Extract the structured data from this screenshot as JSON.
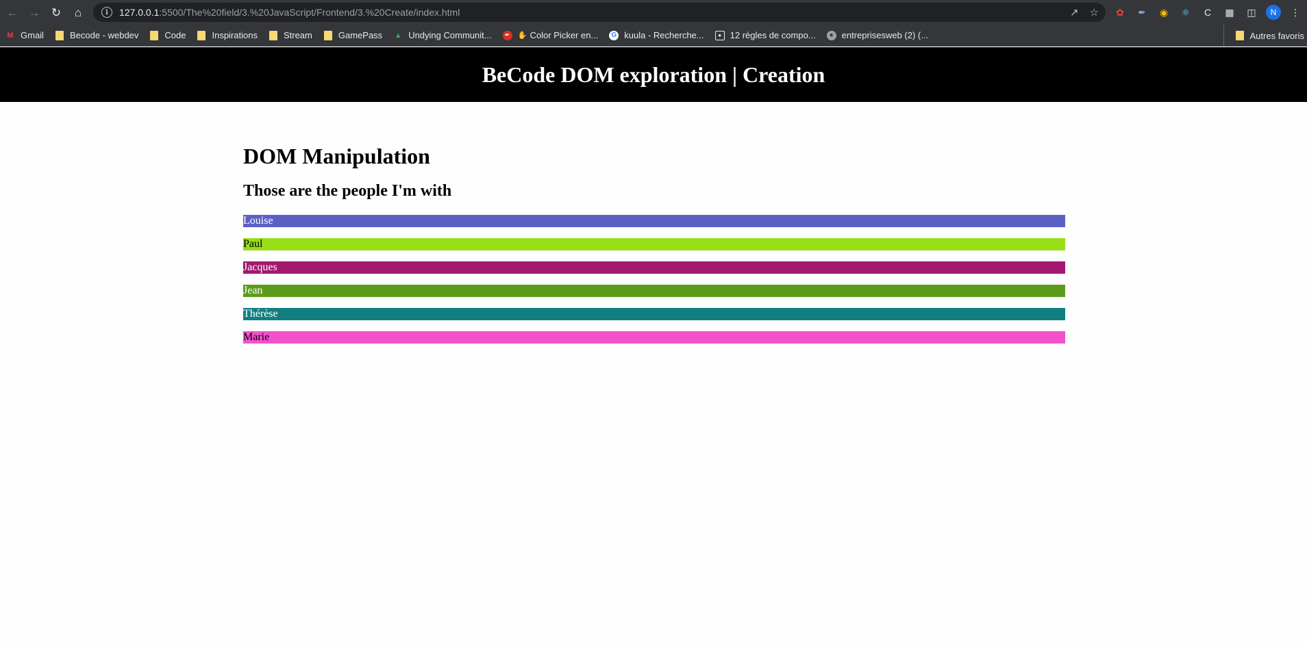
{
  "browser": {
    "url_host": "127.0.0.1",
    "url_rest": ":5500/The%20field/3.%20JavaScript/Frontend/3.%20Create/index.html",
    "profile_initial": "N",
    "bookmarks": [
      {
        "label": "Gmail",
        "icon": "gmail-icon"
      },
      {
        "label": "Becode - webdev",
        "icon": "folder-icon"
      },
      {
        "label": "Code",
        "icon": "folder-icon"
      },
      {
        "label": "Inspirations",
        "icon": "folder-icon"
      },
      {
        "label": "Stream",
        "icon": "folder-icon"
      },
      {
        "label": "GamePass",
        "icon": "folder-icon"
      },
      {
        "label": "Undying Communit...",
        "icon": "drive-icon"
      },
      {
        "label": "Color Picker en...",
        "icon": "color-picker-icon"
      },
      {
        "label": "kuula - Recherche...",
        "icon": "google-icon"
      },
      {
        "label": "12 règles de compo...",
        "icon": "photo-icon"
      },
      {
        "label": "entreprisesweb (2) (...",
        "icon": "globe-icon"
      }
    ],
    "other_bookmarks": "Autres favoris"
  },
  "page": {
    "header_title": "BeCode DOM exploration | Creation",
    "heading": "DOM Manipulation",
    "subheading": "Those are the people I'm with",
    "people": [
      {
        "name": "Louise",
        "bg": "#5b5fc5",
        "fg": "#ffffff"
      },
      {
        "name": "Paul",
        "bg": "#97de17",
        "fg": "#000000"
      },
      {
        "name": "Jacques",
        "bg": "#a2186f",
        "fg": "#ffffff"
      },
      {
        "name": "Jean",
        "bg": "#5c9c1a",
        "fg": "#ffffff"
      },
      {
        "name": "Thérèse",
        "bg": "#127e80",
        "fg": "#ffffff"
      },
      {
        "name": "Marie",
        "bg": "#f352cc",
        "fg": "#000000"
      }
    ]
  }
}
